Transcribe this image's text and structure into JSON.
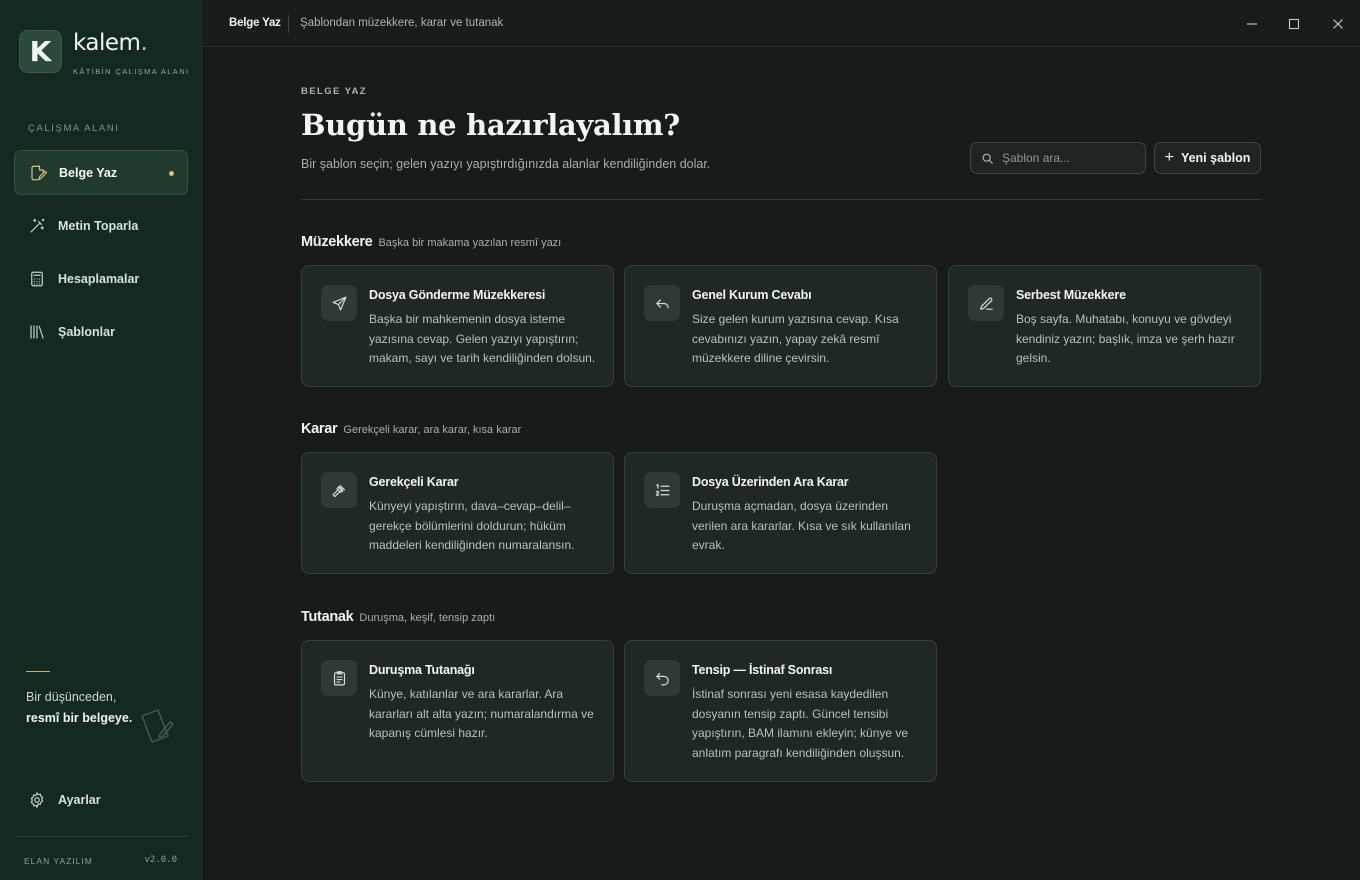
{
  "brand": {
    "logo_letter": "K",
    "name": "kalem",
    "name_dot": ".",
    "tagline": "KÂTİBİN ÇALIŞMA ALANI"
  },
  "sidebar": {
    "section_label": "ÇALIŞMA ALANI",
    "items": [
      {
        "label": "Belge Yaz",
        "icon": "document-edit-icon",
        "active": true
      },
      {
        "label": "Metin Toparla",
        "icon": "magic-wand-icon",
        "active": false
      },
      {
        "label": "Hesaplamalar",
        "icon": "calculator-icon",
        "active": false
      },
      {
        "label": "Şablonlar",
        "icon": "library-icon",
        "active": false
      }
    ],
    "quote_line1": "Bir düşünceden,",
    "quote_line2": "resmî bir belgeye.",
    "settings_label": "Ayarlar",
    "company": "ELAN YAZILIM",
    "version": "v2.0.0"
  },
  "titlebar": {
    "title": "Belge Yaz",
    "subtitle": "Şablondan müzekkere, karar ve tutanak"
  },
  "header": {
    "eyebrow": "BELGE YAZ",
    "title": "Bugün ne hazırlayalım?",
    "subtitle": "Bir şablon seçin; gelen yazıyı yapıştırdığınızda alanlar kendiliğinden dolar.",
    "search_placeholder": "Şablon ara...",
    "new_template_label": "Yeni şablon"
  },
  "groups": [
    {
      "title": "Müzekkere",
      "subtitle": "Başka bir makama yazılan resmî yazı",
      "cards": [
        {
          "title": "Dosya Gönderme Müzekkeresi",
          "icon": "send-icon",
          "description": "Başka bir mahkemenin dosya isteme yazısına cevap. Gelen yazıyı yapıştırın; makam, sayı ve tarih kendiliğinden dolsun."
        },
        {
          "title": "Genel Kurum Cevabı",
          "icon": "reply-icon",
          "description": "Size gelen kurum yazısına cevap. Kısa cevabınızı yazın, yapay zekâ resmî müzekkere diline çevirsin."
        },
        {
          "title": "Serbest Müzekkere",
          "icon": "pen-icon",
          "description": "Boş sayfa. Muhatabı, konuyu ve gövdeyi kendiniz yazın; başlık, imza ve şerh hazır gelsin."
        }
      ]
    },
    {
      "title": "Karar",
      "subtitle": "Gerekçeli karar, ara karar, kısa karar",
      "cards": [
        {
          "title": "Gerekçeli Karar",
          "icon": "gavel-icon",
          "description": "Künyeyi yapıştırın, dava–cevap–delil–gerekçe bölümlerini doldurun; hüküm maddeleri kendiliğinden numaralansın."
        },
        {
          "title": "Dosya Üzerinden Ara Karar",
          "icon": "numbered-list-icon",
          "description": "Duruşma açmadan, dosya üzerinden verilen ara kararlar. Kısa ve sık kullanılan evrak."
        }
      ]
    },
    {
      "title": "Tutanak",
      "subtitle": "Duruşma, keşif, tensip zaptı",
      "cards": [
        {
          "title": "Duruşma Tutanağı",
          "icon": "clipboard-icon",
          "description": "Künye, katılanlar ve ara kararlar. Ara kararları alt alta yazın; numaralandırma ve kapanış cümlesi hazır."
        },
        {
          "title": "Tensip — İstinaf Sonrası",
          "icon": "undo-icon",
          "description": "İstinaf sonrası yeni esasa kaydedilen dosyanın tensip zaptı. Güncel tensibi yapıştırın, BAM ilamını ekleyin; künye ve anlatım paragrafı kendiliğinden oluşsun."
        }
      ]
    }
  ],
  "colors": {
    "sidebar_bg": "#14291f",
    "main_bg": "#171c19",
    "accent_gold": "#d9c27a",
    "card_bg": "#1f2822"
  }
}
